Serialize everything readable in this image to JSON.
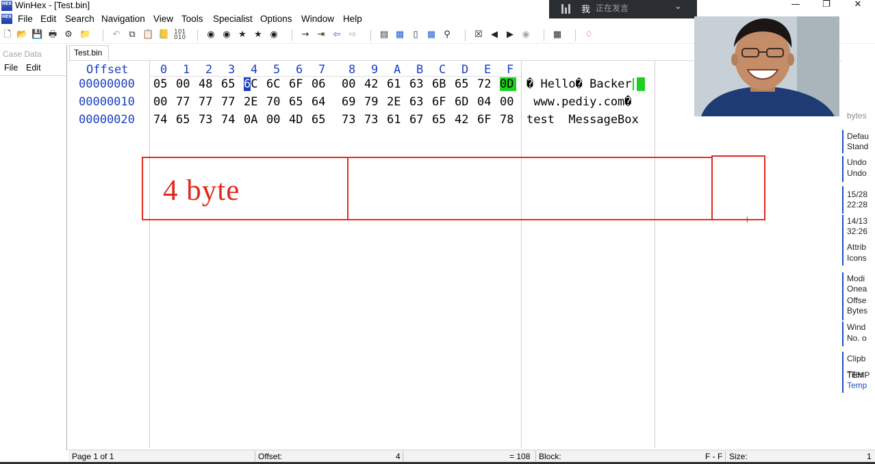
{
  "window": {
    "title": "WinHex - [Test.bin]",
    "icon_label": "HEX"
  },
  "menu": [
    "File",
    "Edit",
    "Search",
    "Navigation",
    "View",
    "Tools",
    "Specialist",
    "Options",
    "Window",
    "Help"
  ],
  "overlay": {
    "user": "我",
    "status": "正在发言",
    "bars_icon": "audio-bars-icon",
    "chevron_icon": "chevron-down-icon"
  },
  "left_panel": {
    "title": "Case Data",
    "menu": [
      "File",
      "Edit"
    ]
  },
  "tab": {
    "label": "Test.bin"
  },
  "hex": {
    "header_offset": "Offset",
    "columns": [
      "0",
      "1",
      "2",
      "3",
      "4",
      "5",
      "6",
      "7",
      "8",
      "9",
      "A",
      "B",
      "C",
      "D",
      "E",
      "F"
    ],
    "rows": [
      {
        "offset": "00000000",
        "bytes": [
          "05",
          "00",
          "48",
          "65",
          "6C",
          "6C",
          "6F",
          "06",
          "00",
          "42",
          "61",
          "63",
          "6B",
          "65",
          "72",
          "0D"
        ],
        "ascii_pre": "� Hel",
        "ascii_post": "lo� Backer"
      },
      {
        "offset": "00000010",
        "bytes": [
          "00",
          "77",
          "77",
          "77",
          "2E",
          "70",
          "65",
          "64",
          "69",
          "79",
          "2E",
          "63",
          "6F",
          "6D",
          "04",
          "00"
        ],
        "ascii": " www.pediy.com�"
      },
      {
        "offset": "00000020",
        "bytes": [
          "74",
          "65",
          "73",
          "74",
          "0A",
          "00",
          "4D",
          "65",
          "73",
          "73",
          "61",
          "67",
          "65",
          "42",
          "6F",
          "78"
        ],
        "ascii": "test  MessageBox"
      }
    ],
    "cursor_cell": {
      "row": 0,
      "col": 4,
      "hi": "6",
      "lo": "C"
    },
    "highlight_cell": {
      "row": 0,
      "col": 15
    }
  },
  "annotation": {
    "text": "4 byte",
    "color": "#e3281d"
  },
  "right_panel": [
    "bytes",
    "Defau",
    "Stand",
    "Undo",
    "Undo",
    "15/28",
    "22:28",
    "14/13",
    "32:26",
    "Attrib",
    "Icons",
    "Modi",
    "Onea",
    "Offse",
    "Bytes",
    "Wind",
    "No. o",
    "Clipb",
    "Tiles",
    "TEMP",
    "Temp"
  ],
  "status": {
    "page": "Page 1 of 1",
    "offset_label": "Offset:",
    "offset_value": "4",
    "equals": "= 108",
    "block_label": "Block:",
    "block_value": "F - F",
    "size_label": "Size:",
    "size_value": "1"
  },
  "colors": {
    "offset_blue": "#1a3ec2",
    "highlight_green": "#1fcf1f",
    "annotation_red": "#e3281d"
  }
}
